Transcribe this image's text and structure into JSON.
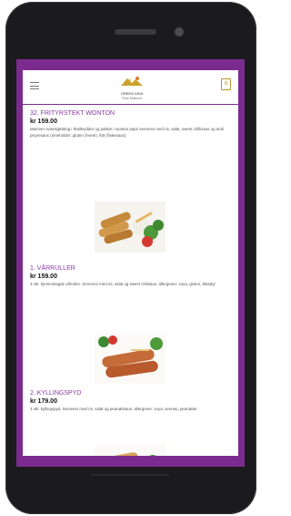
{
  "brand": {
    "name": "GREEN ASIA",
    "subtitle": "Thai Mattern"
  },
  "cart": {
    "count": "0"
  },
  "colors": {
    "frame": "#7b2b8e",
    "accent": "#8b3aa5",
    "cart": "#b5972b"
  },
  "items": [
    {
      "title": "32. FRITYRSTEKT WONTON",
      "price": "kr 159.00",
      "description": "Marinert svinekjøttdeig i thailkrydder og pakket i wonton papir serveres med ris, salat, sweet chillisaus og aroli pisyresaus (Inneholder: gluten (hvete), fisk (fiskesaus)"
    },
    {
      "title": "1. VÅRRULLER",
      "price": "kr 159.00",
      "description": "4 stk. hjemmelagde vårruller. Serveres med ris, salat og sweet chilisaus. allergener: soya, gluten, bløsdyr"
    },
    {
      "title": "2. KYLLINGSPYD",
      "price": "kr 179.00",
      "description": "3 stk. kyllingspyd. Serveres med ris, salat og peanøttsaus. allergener: soya, sennep, peanøtter"
    }
  ]
}
